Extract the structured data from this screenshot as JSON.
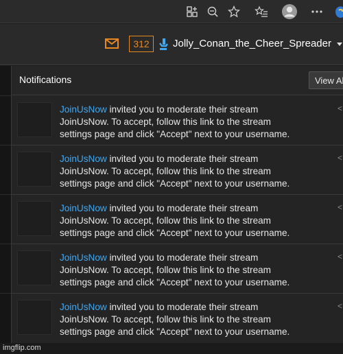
{
  "header": {
    "notification_count": "312",
    "username": "Jolly_Conan_the_Cheer_Spreader",
    "accent_color": "#e8891f",
    "link_color": "#3fa9f5"
  },
  "panel": {
    "title": "Notifications",
    "view_all_label": "View All"
  },
  "notifications": [
    {
      "sender": "JoinUsNow",
      "line1": " invited you to moderate their stream",
      "line2": "JoinUsNow. To accept, follow this link to the stream",
      "line3": "settings page and click \"Accept\" next to your username."
    },
    {
      "sender": "JoinUsNow",
      "line1": " invited you to moderate their stream",
      "line2": "JoinUsNow. To accept, follow this link to the stream",
      "line3": "settings page and click \"Accept\" next to your username."
    },
    {
      "sender": "JoinUsNow",
      "line1": " invited you to moderate their stream",
      "line2": "JoinUsNow. To accept, follow this link to the stream",
      "line3": "settings page and click \"Accept\" next to your username."
    },
    {
      "sender": "JoinUsNow",
      "line1": " invited you to moderate their stream",
      "line2": "JoinUsNow. To accept, follow this link to the stream",
      "line3": "settings page and click \"Accept\" next to your username."
    },
    {
      "sender": "JoinUsNow",
      "line1": " invited you to moderate their stream",
      "line2": "JoinUsNow. To accept, follow this link to the stream",
      "line3": "settings page and click \"Accept\" next to your username."
    }
  ],
  "watermark": "imgflip.com"
}
